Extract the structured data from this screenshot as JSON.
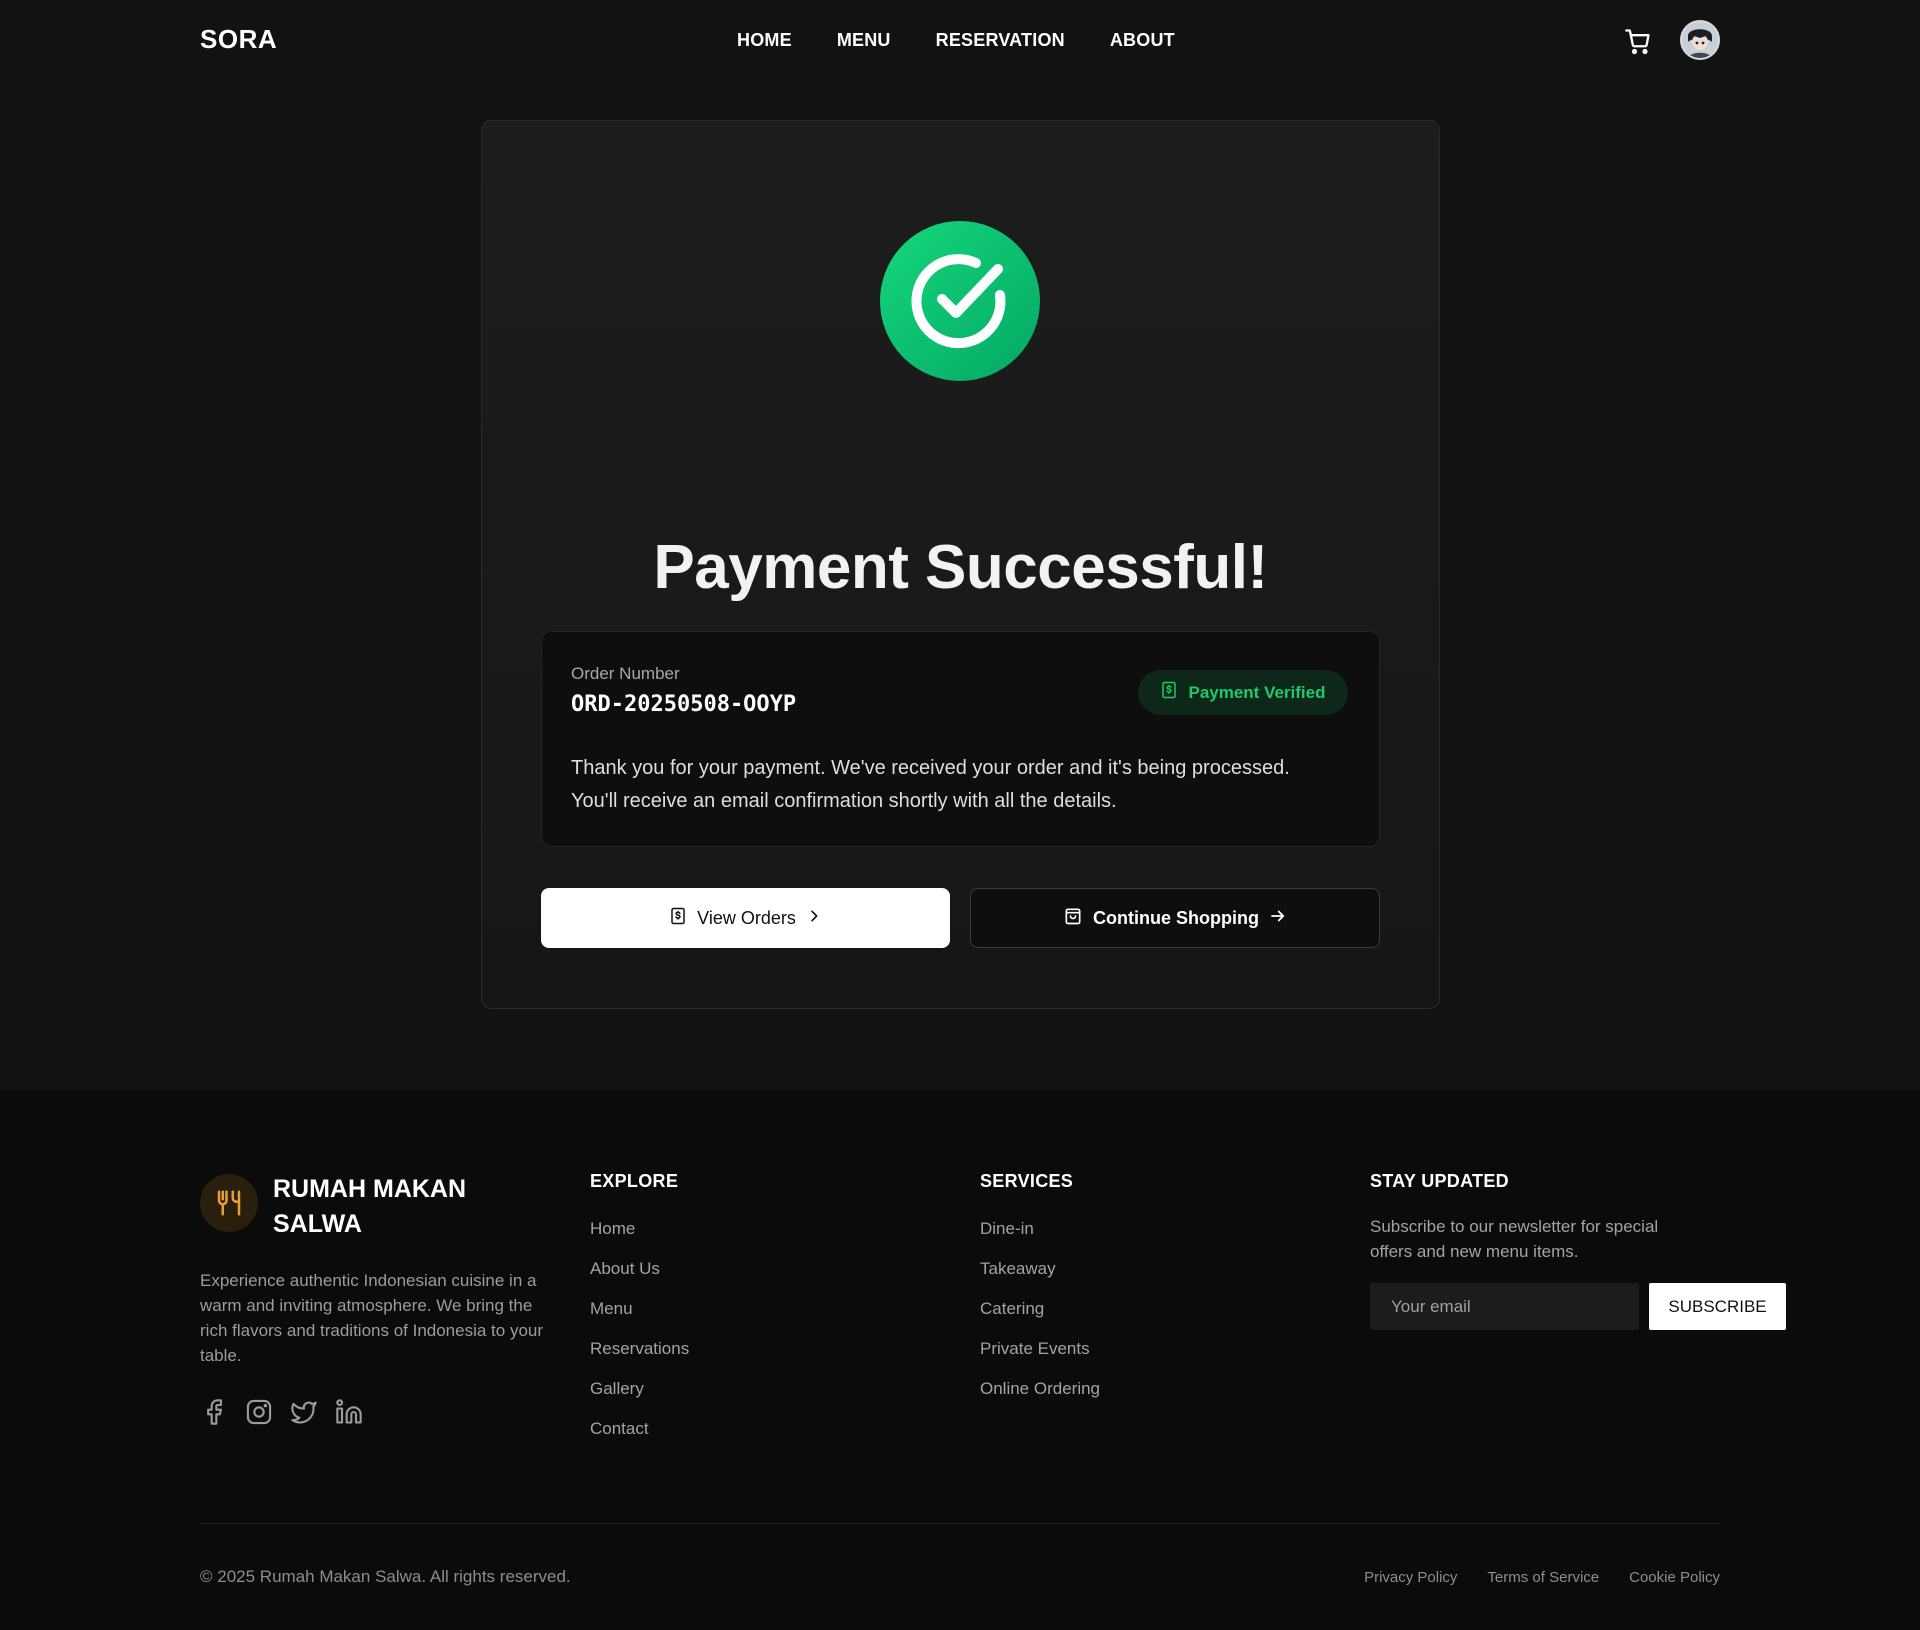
{
  "header": {
    "logo": "SORA",
    "nav": [
      "HOME",
      "MENU",
      "RESERVATION",
      "ABOUT"
    ],
    "cart_icon": "cart-icon",
    "avatar_icon": "user-avatar"
  },
  "main": {
    "status_icon": "check-circle-icon",
    "title": "Payment Successful!",
    "order_label": "Order Number",
    "order_number": "ORD-20250508-OOYP",
    "badge": "Payment Verified",
    "message_line1": "Thank you for your payment. We've received your order and it's being processed.",
    "message_line2": "You'll receive an email confirmation shortly with all the details.",
    "view_orders": "View Orders",
    "continue_shopping": "Continue Shopping"
  },
  "footer": {
    "brand": "RUMAH MAKAN SALWA",
    "description": "Experience authentic Indonesian cuisine in a warm and inviting atmosphere. We bring the rich flavors and traditions of Indonesia to your table.",
    "social_icons": [
      "facebook-icon",
      "instagram-icon",
      "twitter-icon",
      "linkedin-icon"
    ],
    "explore": {
      "title": "EXPLORE",
      "items": [
        "Home",
        "About Us",
        "Menu",
        "Reservations",
        "Gallery",
        "Contact"
      ]
    },
    "services": {
      "title": "SERVICES",
      "items": [
        "Dine-in",
        "Takeaway",
        "Catering",
        "Private Events",
        "Online Ordering"
      ]
    },
    "newsletter": {
      "title": "STAY UPDATED",
      "text": "Subscribe to our newsletter for special offers and new menu items.",
      "placeholder": "Your email",
      "button": "SUBSCRIBE"
    },
    "copyright": "© 2025 Rumah Makan Salwa. All rights reserved.",
    "legal": [
      "Privacy Policy",
      "Terms of Service",
      "Cookie Policy"
    ]
  },
  "colors": {
    "background": "#121212",
    "footer": "#0b0b0b",
    "success_green": "#10c06e",
    "badge_text": "#1fc86e",
    "brand_accent": "#e2a23a"
  }
}
